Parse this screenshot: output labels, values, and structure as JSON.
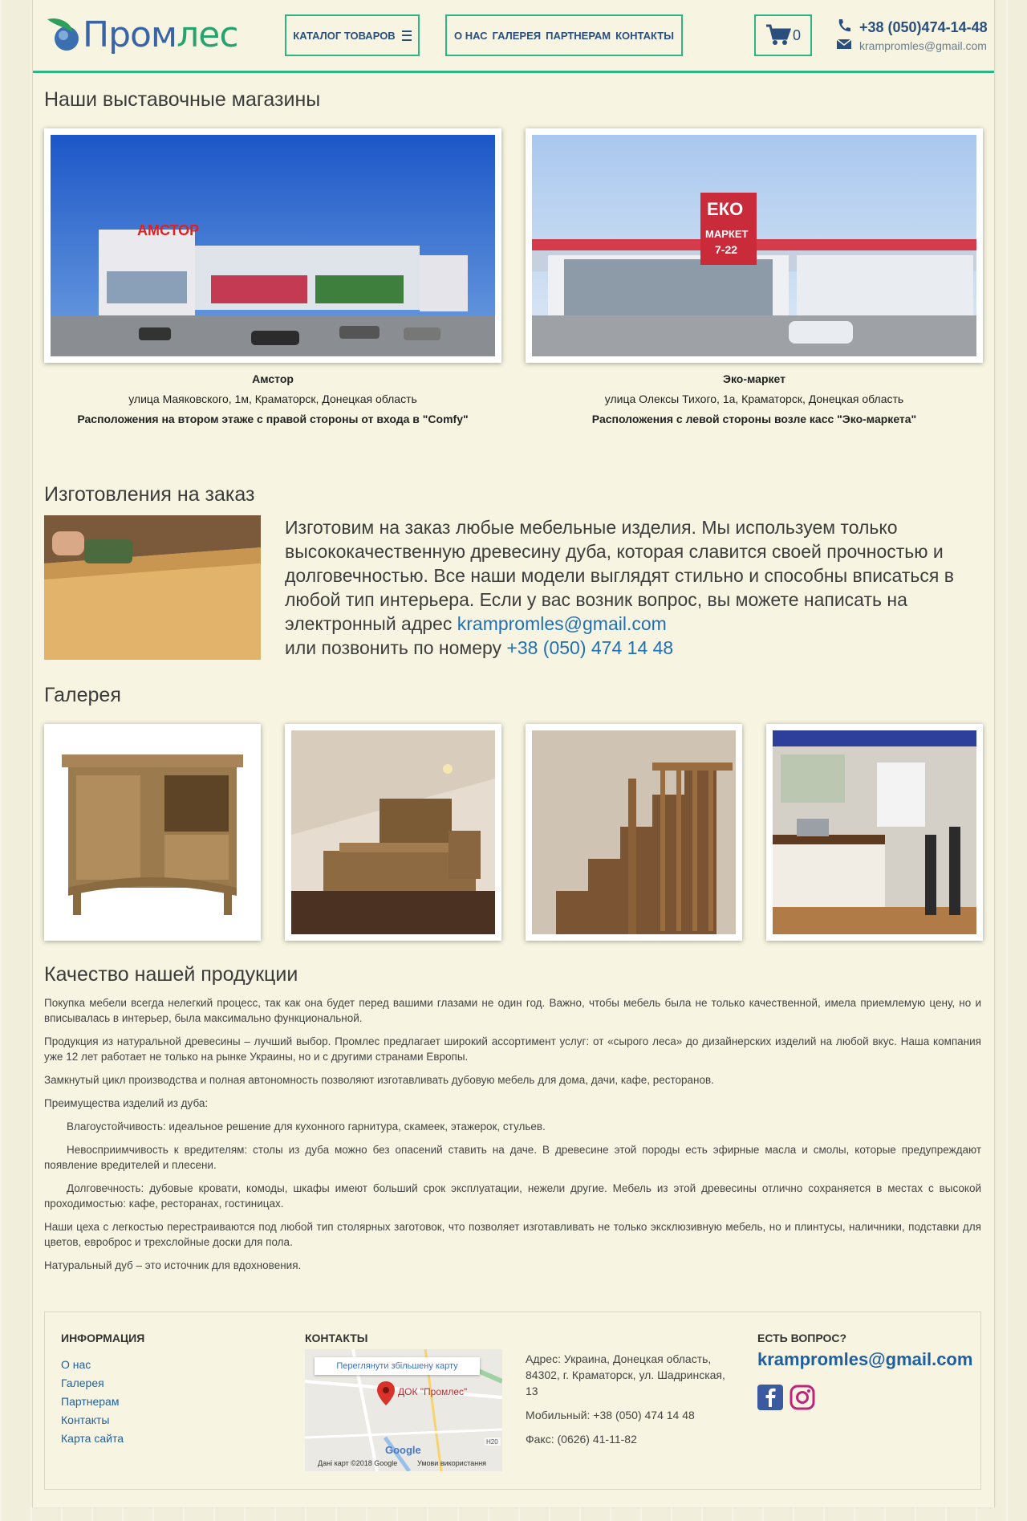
{
  "header": {
    "logo_text_a": "Пром",
    "logo_text_b": "лес",
    "catalog_label": "КАТАЛОГ ТОВАРОВ",
    "nav": [
      "О НАС",
      "ГАЛЕРЕЯ",
      "ПАРТНЕРАМ",
      "КОНТАКТЫ"
    ],
    "cart_count": "0",
    "phone": "+38 (050)474-14-48",
    "email": "krampromles@gmail.com"
  },
  "stores": {
    "title": "Наши выставочные магазины",
    "items": [
      {
        "name": "Амстор",
        "address": "улица Маяковского, 1м, Краматорск, Донецкая область",
        "location": "Расположения на втором этаже с правой стороны от входа в \"Comfy\""
      },
      {
        "name": "Эко-маркет",
        "address": "улица  Олексы Тихого, 1а, Краматорск, Донецкая область",
        "location": "Расположения с левой стороны возле касс \"Эко-маркета\""
      }
    ],
    "sign_1": "АМСТОР",
    "sign_2": "ЕКО",
    "sign_3": "МАРКЕТ",
    "sign_4": "7-22"
  },
  "order": {
    "title": "Изготовления на заказ",
    "text": "Изготовим на заказ любые мебельные изделия. Мы используем только высококачественную древесину дуба, которая славится своей прочностью и долговечностью. Все наши модели выглядят стильно и способны вписаться в любой тип интерьера. Если у вас возник вопрос, вы можете написать на электронный адрес ",
    "email": "krampromles@gmail.com",
    "phone_intro": "или позвонить по номеру ",
    "phone": "+38 (050) 474 14 48"
  },
  "gallery": {
    "title": "Галерея"
  },
  "quality": {
    "title": "Качество нашей продукции",
    "paragraphs": [
      "Покупка мебели всегда нелегкий процесс, так как она будет перед вашими глазами не один год. Важно, чтобы мебель была не только качественной, имела приемлемую цену, но и вписывалась в интерьер, была максимально функциональной.",
      "Продукция из натуральной древесины – лучший выбор. Промлес предлагает широкий ассортимент услуг: от «сырого леса» до дизайнерских изделий на любой вкус. Наша компания уже 12 лет работает не только на рынке Украины, но и с другими странами Европы.",
      "Замкнутый цикл производства и полная автономность позволяют изготавливать дубовую мебель для дома, дачи, кафе, ресторанов.",
      "Преимущества изделий из дуба:",
      "Влагоустойчивость: идеальное решение для кухонного гарнитура, скамеек, этажерок, стульев.",
      "Невосприимчивость к вредителям: столы из дуба можно без опасений ставить на даче. В древесине этой породы есть эфирные масла и смолы, которые предупреждают появление вредителей и плесени.",
      "Долговечность: дубовые кровати, комоды, шкафы имеют больший срок эксплуатации, нежели другие. Мебель из этой древесины отлично сохраняется в местах с высокой проходимостью: кафе, ресторанах, гостиницах.",
      "Наши цеха с легкостью перестраиваются под любой тип столярных заготовок, что позволяет изготавливать не только эксклюзивную мебель, но и плинтусы, наличники, подставки для цветов, евроброс и трехслойные доски для пола.",
      "Натуральный дуб – это источник для вдохновения."
    ]
  },
  "footer": {
    "info_title": "ИНФОРМАЦИЯ",
    "links": [
      "О нас",
      "Галерея",
      "Партнерам",
      "Контакты",
      "Карта сайта"
    ],
    "contacts_title": "КОНТАКТЫ",
    "map_button": "Переглянути збільшену карту",
    "map_pin_label": "ДОК \"Промлес\"",
    "map_google": "Google",
    "map_copyright": "Дані карт ©2018 Google",
    "map_terms": "Умови використання",
    "map_road": "H20",
    "address": "Адрес: Украина, Донецкая область, 84302, г. Краматорск, ул. Шадринская, 13",
    "mobile": "Мобильный: +38 (050) 474 14 48",
    "fax": "Факс: (0626) 41-11-82",
    "question_title": "ЕСТЬ ВОПРОС?",
    "question_email": "krampromles@gmail.com"
  }
}
